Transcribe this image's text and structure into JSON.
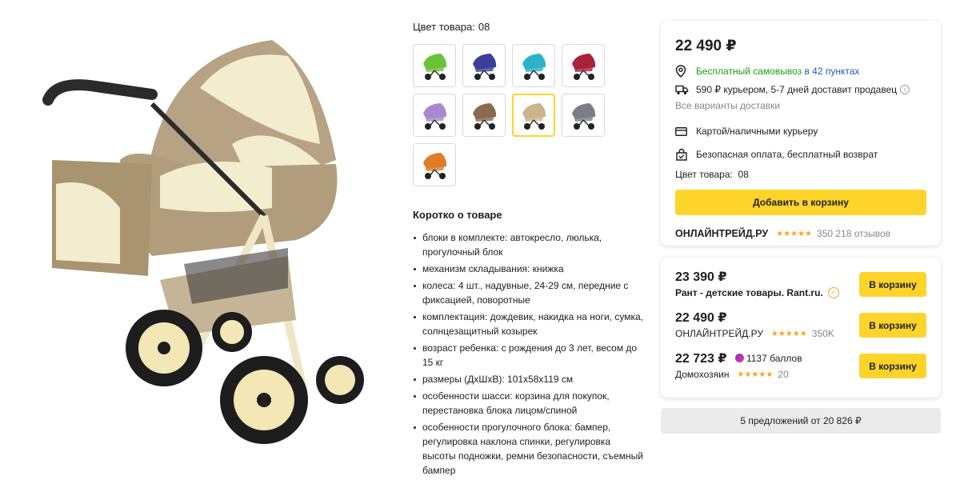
{
  "product": {
    "image_alt": "stroller-beige"
  },
  "color": {
    "label": "Цвет товара:",
    "value": "08",
    "swatches": [
      {
        "name": "green",
        "hex": "#6bc23a"
      },
      {
        "name": "navy",
        "hex": "#3b3f9a"
      },
      {
        "name": "turquoise",
        "hex": "#2db3c9"
      },
      {
        "name": "dark-red",
        "hex": "#a8233a"
      },
      {
        "name": "lilac",
        "hex": "#a98ad0"
      },
      {
        "name": "brown",
        "hex": "#8a6b4f"
      },
      {
        "name": "beige",
        "hex": "#c9b58c"
      },
      {
        "name": "gray",
        "hex": "#7a7f87"
      },
      {
        "name": "orange",
        "hex": "#e07c2a"
      }
    ],
    "selected_index": 6
  },
  "about": {
    "title": "Коротко о товаре",
    "features": [
      "блоки в комплекте: автокресло, люлька, прогулочный блок",
      "механизм складывания: книжка",
      "колеса: 4 шт., надувные, 24-29 см, передние с фиксацией, поворотные",
      "комплектация: дождевик, накидка на ноги, сумка, солнцезащитный козырек",
      "возраст ребенка: с рождения до 3 лет, весом до 15 кг",
      "размеры (ДхШхВ): 101x58x119 см",
      "особенности шасси: корзина для покупок, перестановка блока лицом/спиной",
      "особенности прогулочного блока: бампер, регулировка наклона спинки, регулировка высоты подножки, ремни безопасности, съемный бампер"
    ]
  },
  "buy": {
    "price": "22 490 ₽",
    "pickup_text": "Бесплатный самовывоз",
    "pickup_link": "в 42 пунктах",
    "courier_text": "590 ₽ курьером, 5-7 дней доставит продавец",
    "info": "i",
    "all_delivery": "Все варианты доставки",
    "payment": "Картой/наличными курьеру",
    "safe_payment": "Безопасная оплата, бесплатный возврат",
    "color_label": "Цвет товара:",
    "color_value": "08",
    "add_to_cart": "Добавить в корзину",
    "seller": "ОНЛАЙНТРЕЙД.РУ",
    "stars": "★★★★★",
    "reviews": "350 218 отзывов"
  },
  "offers": [
    {
      "price": "23 390 ₽",
      "seller": "Рант - детские товары. Rant.ru.",
      "verified": "✓",
      "stars": "",
      "count": "",
      "button": "В корзину"
    },
    {
      "price": "22 490 ₽",
      "seller": "ОНЛАЙНТРЕЙД.РУ",
      "stars": "★★★★★",
      "count": "350K",
      "button": "В корзину"
    },
    {
      "price": "22 723 ₽",
      "bonus": "1137 баллов",
      "seller": "Домохозяин",
      "stars": "★★★★★",
      "count": "20",
      "button": "В корзину"
    }
  ],
  "all_offers": "5 предложений от 20 826 ₽"
}
